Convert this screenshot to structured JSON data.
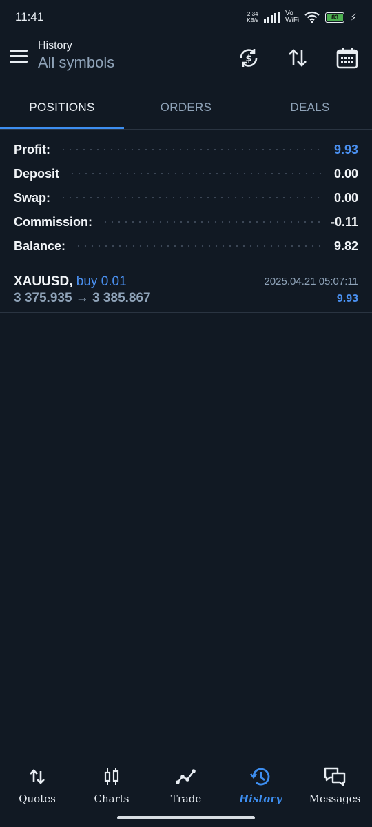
{
  "status_bar": {
    "time": "11:41",
    "net_speed_value": "2.34",
    "net_speed_unit": "KB/s",
    "vowifi_top": "Vo",
    "vowifi_bottom": "WiFi",
    "battery": "83"
  },
  "header": {
    "title": "History",
    "subtitle": "All symbols",
    "icons": [
      "sync-currency-icon",
      "sort-icon",
      "calendar-icon"
    ]
  },
  "tabs": [
    {
      "label": "POSITIONS",
      "active": true
    },
    {
      "label": "ORDERS",
      "active": false
    },
    {
      "label": "DEALS",
      "active": false
    }
  ],
  "summary": [
    {
      "label": "Profit:",
      "value": "9.93"
    },
    {
      "label": "Deposit",
      "value": "0.00"
    },
    {
      "label": "Swap:",
      "value": "0.00"
    },
    {
      "label": "Commission:",
      "value": "-0.11"
    },
    {
      "label": "Balance:",
      "value": "9.82"
    }
  ],
  "positions": [
    {
      "symbol": "XAUUSD,",
      "side": "buy 0.01",
      "prices": "3 375.935 → 3 385.867",
      "date": "2025.04.21 05:07:11",
      "profit": "9.93"
    }
  ],
  "nav": [
    {
      "label": "Quotes",
      "icon": "quotes-icon",
      "active": false
    },
    {
      "label": "Charts",
      "icon": "charts-icon",
      "active": false
    },
    {
      "label": "Trade",
      "icon": "trade-icon",
      "active": false
    },
    {
      "label": "History",
      "icon": "history-icon",
      "active": true
    },
    {
      "label": "Messages",
      "icon": "messages-icon",
      "active": false
    }
  ],
  "colors": {
    "background": "#111923",
    "accent": "#3d8ef0",
    "muted": "#8fa3b8"
  }
}
